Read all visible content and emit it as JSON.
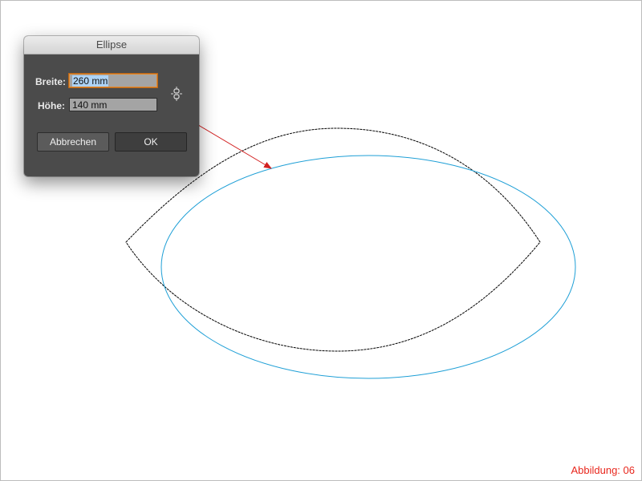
{
  "dialog": {
    "title": "Ellipse",
    "width_label": "Breite:",
    "width_value": "260 mm",
    "height_label": "Höhe:",
    "height_value": "140 mm",
    "cancel_label": "Abbrechen",
    "ok_label": "OK",
    "link_icon": "chain-link-icon"
  },
  "canvas": {
    "shapes": [
      "leaf-shape",
      "ellipse"
    ],
    "colors": {
      "ellipse_stroke": "#1e9fd6",
      "leaf_stroke": "#000000",
      "arrow": "#d21f1f"
    }
  },
  "caption": "Abbildung: 06"
}
